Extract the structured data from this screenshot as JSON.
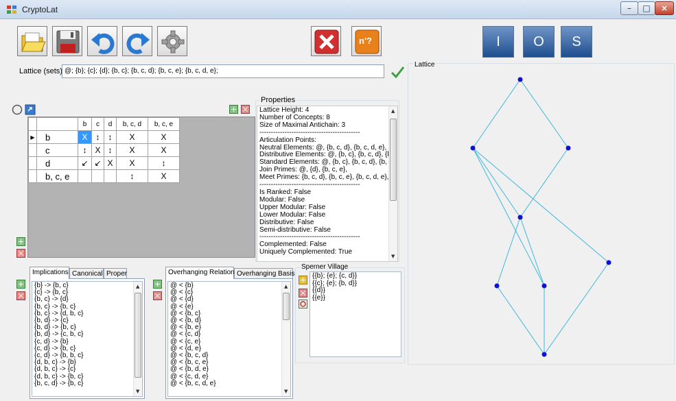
{
  "window": {
    "title": "CryptoLat"
  },
  "toolbar": {
    "no_label": "n'?",
    "i_label": "I",
    "o_label": "O",
    "s_label": "S"
  },
  "lattice_input": {
    "label": "Lattice (sets):",
    "value": "@; {b}; {c}; {d}; {b, c}; {b, c, d}; {b, c, e}; {b, c, d, e};"
  },
  "context_table": {
    "columns": [
      "b",
      "c",
      "d",
      "b, c, d",
      "b, c, e"
    ],
    "rows": [
      {
        "label": "b",
        "cells": [
          "X",
          "↕",
          "↕",
          "X",
          "X"
        ]
      },
      {
        "label": "c",
        "cells": [
          "↕",
          "X",
          "↕",
          "X",
          "X"
        ]
      },
      {
        "label": "d",
        "cells": [
          "↙",
          "↙",
          "X",
          "X",
          "↕"
        ]
      },
      {
        "label": "b, c, e",
        "cells": [
          "",
          "",
          "",
          "↕",
          "X"
        ]
      }
    ]
  },
  "properties": {
    "title": "Properties",
    "lines": [
      "Lattice Height: 4",
      "Number of Concepts: 8",
      "Size of Maximal Antichain: 3",
      "--------------------------------------------",
      "Articulation Points:",
      "Neutral Elements: @, {b, c, d}, {b, c, d, e},",
      "Distributive Elements: @, {b, c}, {b, c, d}, {b, c",
      "Standard Elements: @, {b, c}, {b, c, d}, {b, c, e",
      "Join Primes: @, {d}, {b, c, e},",
      "Meet Primes: {b, c, d}, {b, c, e}, {b, c, d, e},",
      "--------------------------------------------",
      "Is Ranked: False",
      "Modular: False",
      "Upper Modular: False",
      "Lower Modular: False",
      "Distributive: False",
      "Semi-distributive: False",
      "--------------------------------------------",
      "Complemented: False",
      "Uniquely Complemented: True"
    ]
  },
  "lattice_panel": {
    "title": "Lattice"
  },
  "implications": {
    "tabs": [
      "Implications",
      "Canonical",
      "Proper"
    ],
    "items": [
      "{b} -> {b, c}",
      "{c} -> {b, c}",
      "{b, c} -> {d}",
      "{b, c} -> {b, c}",
      "{b, c} -> {d, b, c}",
      "{b, d} -> {c}",
      "{b, d} -> {b, c}",
      "{b, d} -> {c, b, c}",
      "{c, d} -> {b}",
      "{c, d} -> {b, c}",
      "{c, d} -> {b, b, c}",
      "{d, b, c} -> {b}",
      "{d, b, c} -> {c}",
      "{d, b, c} -> {b, c}",
      "{b, c, d} -> {b, c}"
    ]
  },
  "overhanging": {
    "tabs": [
      "Overhanging Relation",
      "Overhanging Basis"
    ],
    "items": [
      "@ < {b}",
      "@ < {c}",
      "@ < {d}",
      "@ < {e}",
      "@ < {b, c}",
      "@ < {b, d}",
      "@ < {b, e}",
      "@ < {c, d}",
      "@ < {c, e}",
      "@ < {d, e}",
      "@ < {b, c, d}",
      "@ < {b, c, e}",
      "@ < {b, d, e}",
      "@ < {c, d, e}",
      "@ < {b, c, d, e}"
    ]
  },
  "sperner": {
    "title": "Sperner Village",
    "items": [
      "{{b}; {e}; {c, d}}",
      "{{c}; {e}; {b, d}}",
      "{{d}}",
      "{{e}}"
    ]
  }
}
